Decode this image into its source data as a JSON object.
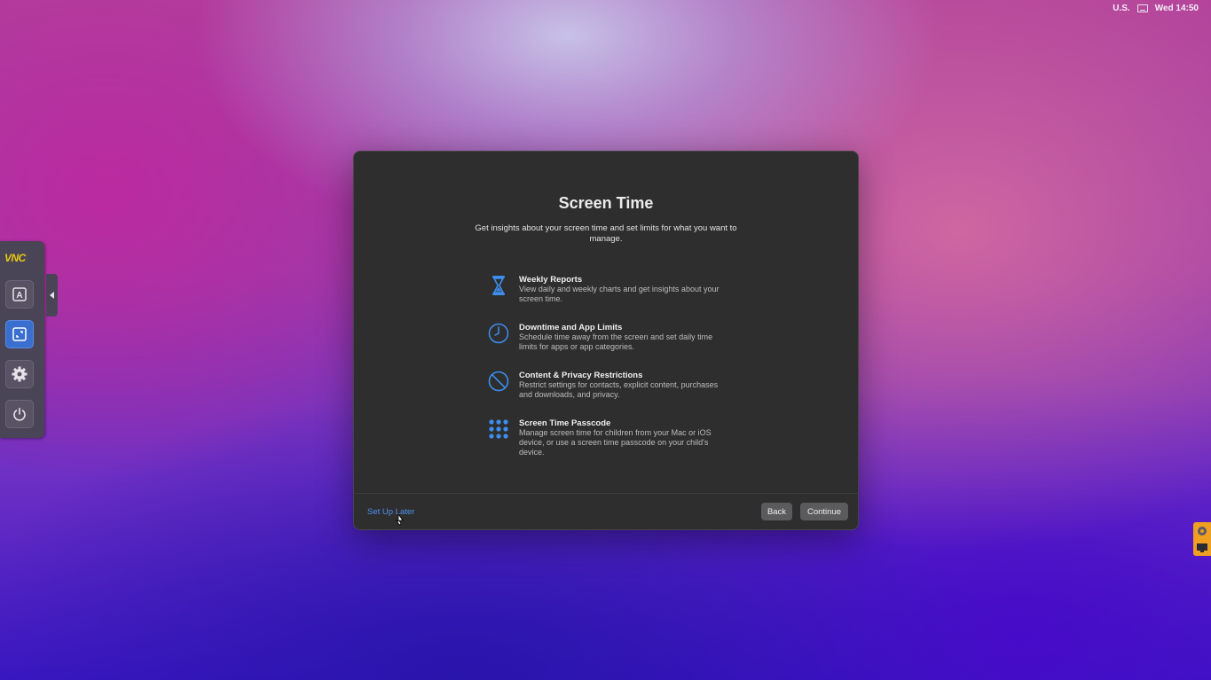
{
  "menubar": {
    "input_source": "U.S.",
    "input_icon": "keyboard-icon",
    "clock": "Wed 14:50"
  },
  "vnc_toolbar": {
    "logo": "VNC",
    "buttons": [
      {
        "icon": "keyboard-a-icon"
      },
      {
        "icon": "fit-screen-icon",
        "active": true
      },
      {
        "icon": "gear-icon"
      },
      {
        "icon": "power-icon"
      }
    ],
    "collapse_icon": "chevron-left-icon"
  },
  "dialog": {
    "title": "Screen Time",
    "subtitle": "Get insights about your screen time and set limits for what you want to manage.",
    "features": [
      {
        "icon": "hourglass-icon",
        "title": "Weekly Reports",
        "description": "View daily and weekly charts and get insights about your screen time."
      },
      {
        "icon": "clock-icon",
        "title": "Downtime and App Limits",
        "description": "Schedule time away from the screen and set daily time limits for apps or app categories."
      },
      {
        "icon": "prohibited-icon",
        "title": "Content & Privacy Restrictions",
        "description": "Restrict settings for contacts, explicit content, purchases and downloads, and privacy."
      },
      {
        "icon": "keypad-icon",
        "title": "Screen Time Passcode",
        "description": "Manage screen time for children from your Mac or iOS device, or use a screen time passcode on your child's device."
      }
    ],
    "setup_later": "Set Up Later",
    "back": "Back",
    "continue": "Continue"
  },
  "colors": {
    "accent": "#4f93f0",
    "dialog_bg": "#2e2e2f",
    "vnc_active": "#3a6fd0",
    "tray": "#f0a020"
  }
}
